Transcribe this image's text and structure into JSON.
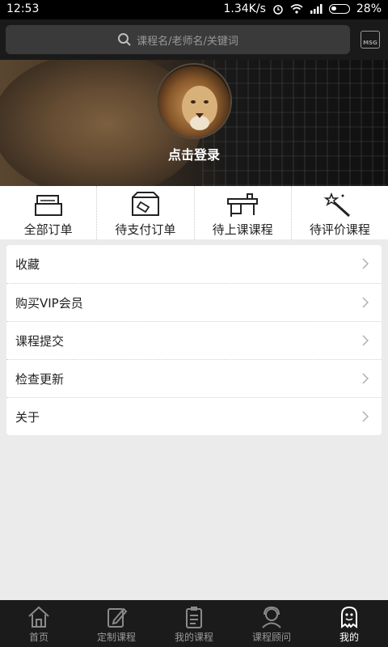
{
  "status_bar": {
    "time": "12:53",
    "speed": "1.34K/s",
    "battery": "28%"
  },
  "search": {
    "placeholder": "课程名/老师名/关键词",
    "icon": "search-icon"
  },
  "header": {
    "msg_label": "MSG"
  },
  "profile": {
    "login_text": "点击登录"
  },
  "orders": [
    {
      "label": "全部订单",
      "icon": "orders-icon"
    },
    {
      "label": "待支付订单",
      "icon": "payment-icon"
    },
    {
      "label": "待上课课程",
      "icon": "classroom-icon"
    },
    {
      "label": "待评价课程",
      "icon": "magic-wand-icon"
    }
  ],
  "menu": [
    {
      "label": "收藏"
    },
    {
      "label": "购买VIP会员"
    },
    {
      "label": "课程提交"
    },
    {
      "label": "检查更新"
    },
    {
      "label": "关于"
    }
  ],
  "tabs": [
    {
      "label": "首页",
      "icon": "home-icon",
      "active": false
    },
    {
      "label": "定制课程",
      "icon": "edit-icon",
      "active": false
    },
    {
      "label": "我的课程",
      "icon": "clipboard-icon",
      "active": false
    },
    {
      "label": "课程顾问",
      "icon": "advisor-icon",
      "active": false
    },
    {
      "label": "我的",
      "icon": "ghost-icon",
      "active": true
    }
  ],
  "colors": {
    "active_tab": "#ffffff",
    "inactive_tab": "#9a9a9a",
    "tabbar_bg": "#1b1b1b"
  }
}
